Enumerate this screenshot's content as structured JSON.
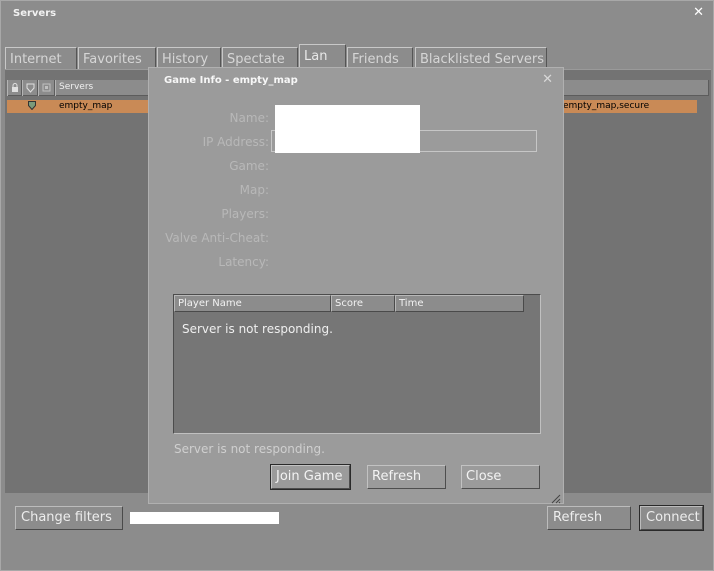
{
  "window": {
    "title": "Servers",
    "close_glyph": "✕"
  },
  "tabs": [
    {
      "label": "Internet"
    },
    {
      "label": "Favorites"
    },
    {
      "label": "History"
    },
    {
      "label": "Spectate"
    },
    {
      "label": "Lan",
      "active": true
    },
    {
      "label": "Friends"
    },
    {
      "label": "Blacklisted Servers"
    }
  ],
  "server_list": {
    "columns": {
      "lock_icon": "lock-icon",
      "secure_icon": "shield-icon",
      "bots_icon": "bots-icon",
      "servers": "Servers"
    },
    "rows": [
      {
        "name": "empty_map",
        "tags": "empty_map,secure",
        "secure_icon": "shield-icon"
      }
    ]
  },
  "bottom": {
    "change_filters": "Change filters",
    "refresh": "Refresh",
    "connect": "Connect"
  },
  "dialog": {
    "title": "Game Info - empty_map",
    "close_glyph": "✕",
    "labels": {
      "name": "Name:",
      "ip": "IP Address:",
      "game": "Game:",
      "map": "Map:",
      "players": "Players:",
      "vac": "Valve Anti-Cheat:",
      "latency": "Latency:"
    },
    "player_table": {
      "col_name": "Player Name",
      "col_score": "Score",
      "col_time": "Time",
      "message": "Server is not responding."
    },
    "status": "Server is not responding.",
    "buttons": {
      "join": "Join Game",
      "refresh": "Refresh",
      "close": "Close"
    }
  },
  "colors": {
    "selected_row": "#c98a56",
    "background": "#8c8c8c",
    "dialog_bg": "#9b9b9b"
  }
}
